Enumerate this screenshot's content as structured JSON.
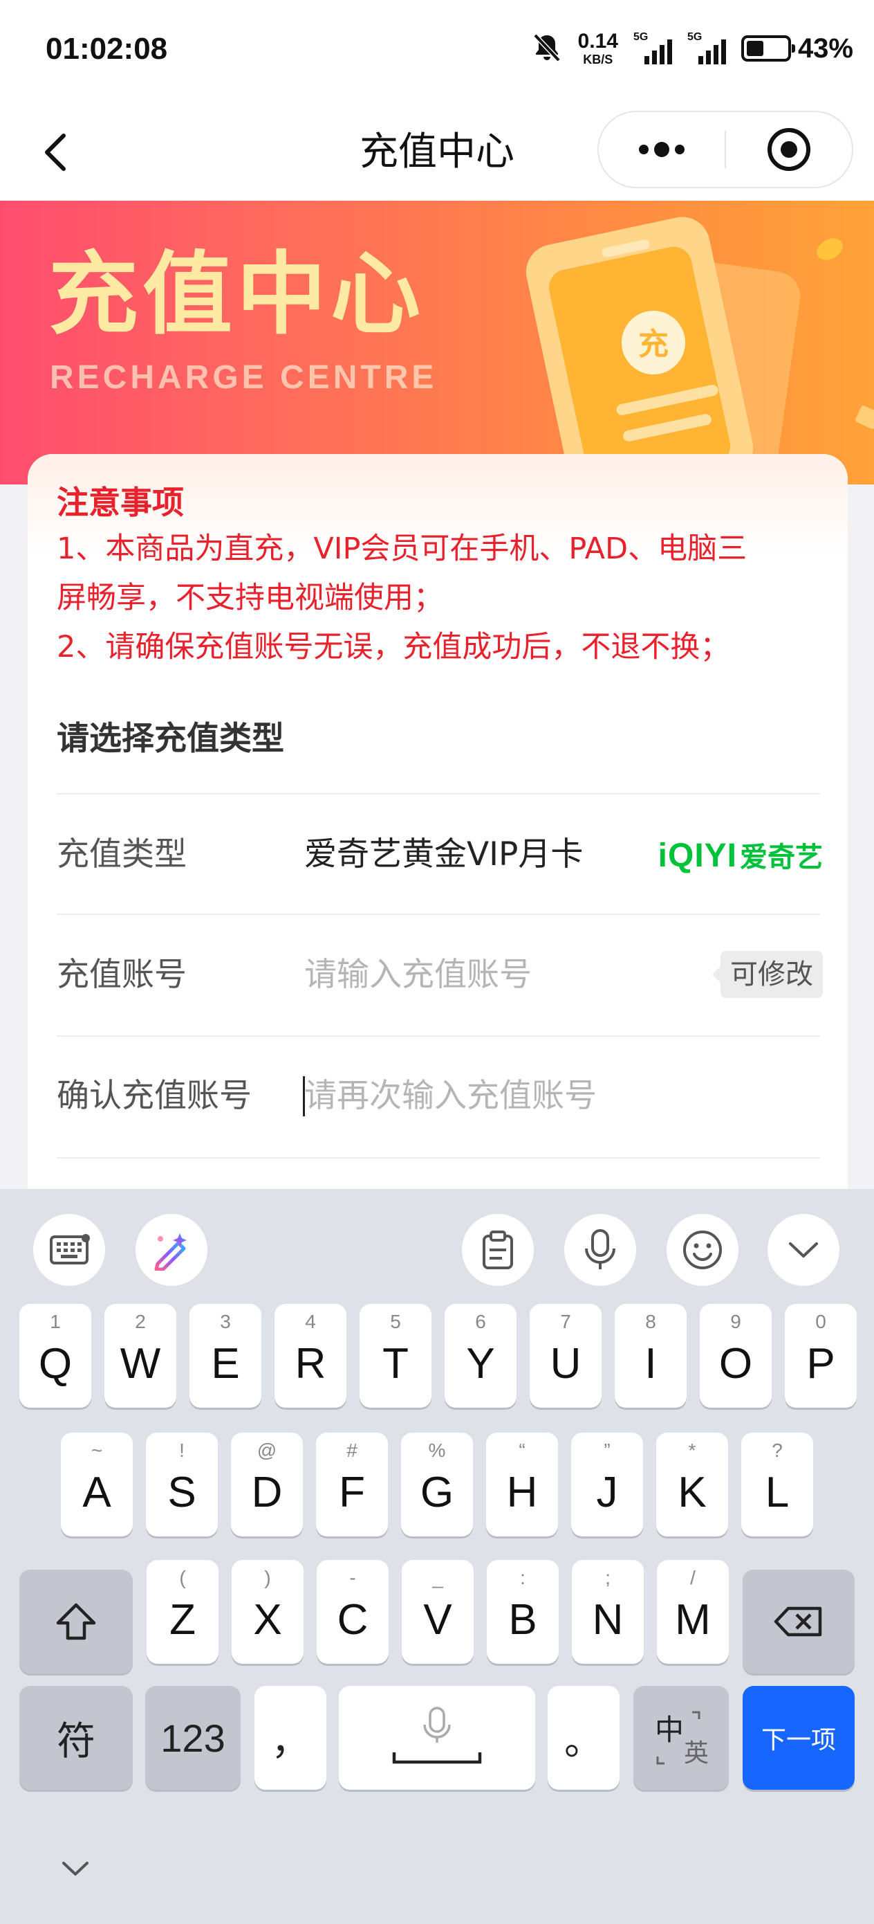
{
  "status_bar": {
    "time": "01:02:08",
    "net_speed_value": "0.14",
    "net_speed_unit": "KB/S",
    "sim1_tag": "5G",
    "sim2_tag": "5G",
    "battery_percent": "43%",
    "battery_level": 0.43
  },
  "nav": {
    "title": "充值中心"
  },
  "banner": {
    "title": "充值中心",
    "subtitle": "RECHARGE CENTRE",
    "badge_char": "充"
  },
  "notice": {
    "title": "注意事项",
    "line1": "1、本商品为直充，VIP会员可在手机、PAD、电脑三",
    "line2": "屏畅享，不支持电视端使用；",
    "line3": "2、请确保充值账号无误，充值成功后，不退不换；"
  },
  "form": {
    "section_title": "请选择充值类型",
    "type_label": "充值类型",
    "type_value": "爱奇艺黄金VIP月卡",
    "brand_logo_en": "iQIYI",
    "brand_logo_cn": "爱奇艺",
    "account_label": "充值账号",
    "account_placeholder": "请输入充值账号",
    "editable_badge": "可修改",
    "confirm_label": "确认充值账号",
    "confirm_placeholder": "请再次输入充值账号"
  },
  "keyboard": {
    "row1": [
      {
        "hint": "1",
        "ch": "Q"
      },
      {
        "hint": "2",
        "ch": "W"
      },
      {
        "hint": "3",
        "ch": "E"
      },
      {
        "hint": "4",
        "ch": "R"
      },
      {
        "hint": "5",
        "ch": "T"
      },
      {
        "hint": "6",
        "ch": "Y"
      },
      {
        "hint": "7",
        "ch": "U"
      },
      {
        "hint": "8",
        "ch": "I"
      },
      {
        "hint": "9",
        "ch": "O"
      },
      {
        "hint": "0",
        "ch": "P"
      }
    ],
    "row2": [
      {
        "hint": "~",
        "ch": "A"
      },
      {
        "hint": "!",
        "ch": "S"
      },
      {
        "hint": "@",
        "ch": "D"
      },
      {
        "hint": "#",
        "ch": "F"
      },
      {
        "hint": "%",
        "ch": "G"
      },
      {
        "hint": "“",
        "ch": "H"
      },
      {
        "hint": "”",
        "ch": "J"
      },
      {
        "hint": "*",
        "ch": "K"
      },
      {
        "hint": "?",
        "ch": "L"
      }
    ],
    "row3": [
      {
        "hint": "(",
        "ch": "Z"
      },
      {
        "hint": ")",
        "ch": "X"
      },
      {
        "hint": "-",
        "ch": "C"
      },
      {
        "hint": "_",
        "ch": "V"
      },
      {
        "hint": ":",
        "ch": "B"
      },
      {
        "hint": ";",
        "ch": "N"
      },
      {
        "hint": "/",
        "ch": "M"
      }
    ],
    "symbols_key": "符",
    "numbers_key": "123",
    "comma_key": "，",
    "period_key": "。",
    "lang_key_main": "中",
    "lang_key_alt": "英",
    "next_key": "下一项"
  }
}
